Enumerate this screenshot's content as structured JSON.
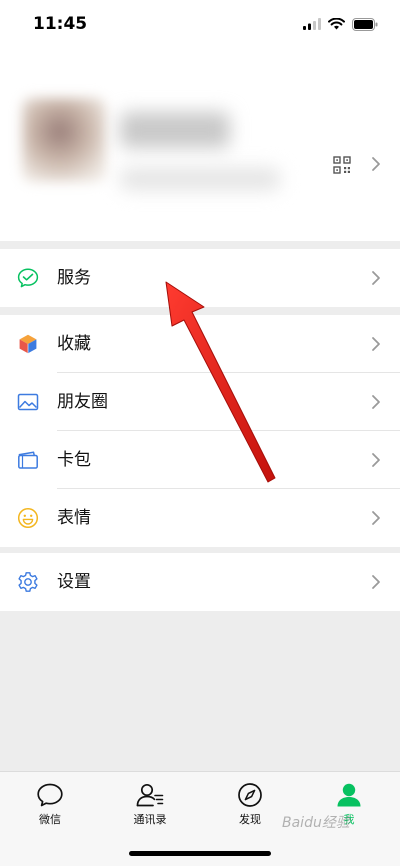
{
  "status_bar": {
    "time": "11:45"
  },
  "menu": {
    "services": {
      "label": "服务"
    },
    "favorites": {
      "label": "收藏"
    },
    "moments": {
      "label": "朋友圈"
    },
    "cards": {
      "label": "卡包"
    },
    "stickers": {
      "label": "表情"
    },
    "settings": {
      "label": "设置"
    }
  },
  "tabbar": {
    "chats": "微信",
    "contacts": "通讯录",
    "discover": "发现",
    "me": "我"
  },
  "watermark": "Baidu经验",
  "colors": {
    "accent_green": "#07c160",
    "arrow_red": "#e3211b",
    "background": "#ededed"
  }
}
